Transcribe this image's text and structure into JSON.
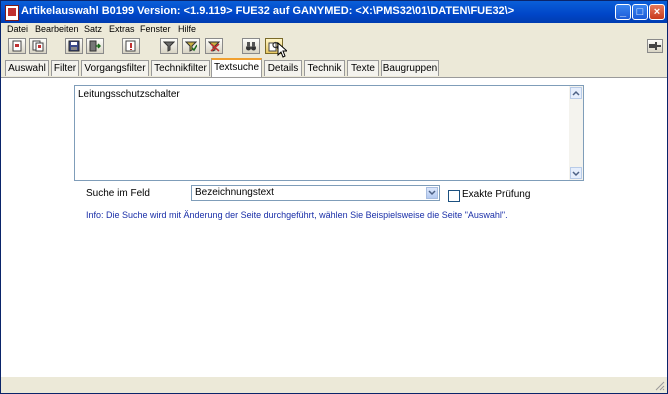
{
  "window": {
    "title": "Artikelauswahl B0199 Version: <1.9.119> FUE32 auf GANYMED: <X:\\PMS32\\01\\DATEN\\FUE32\\>"
  },
  "menu": [
    "Datei",
    "Bearbeiten",
    "Satz",
    "Extras",
    "Fenster",
    "Hilfe"
  ],
  "tabs": [
    "Auswahl",
    "Filter",
    "Vorgangsfilter",
    "Technikfilter",
    "Textsuche",
    "Details",
    "Technik",
    "Texte",
    "Baugruppen"
  ],
  "active_tab": "Textsuche",
  "search": {
    "text": "Leitungsschutzschalter",
    "field_label": "Suche im Feld",
    "field_value": "Bezeichnungstext",
    "exact_label": "Exakte Prüfung",
    "exact_checked": false
  },
  "info": "Info: Die Suche wird mit Änderung der Seite durchgeführt, wählen Sie Beispielsweise die Seite \"Auswahl\"."
}
